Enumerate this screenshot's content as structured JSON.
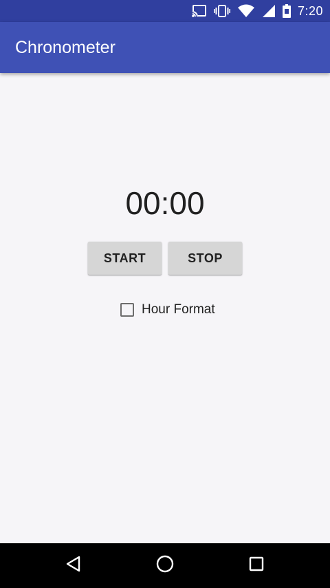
{
  "status_bar": {
    "time": "7:20",
    "icons": [
      "cast-icon",
      "vibrate-icon",
      "wifi-icon",
      "signal-icon",
      "battery-icon"
    ]
  },
  "app_bar": {
    "title": "Chronometer",
    "color": "#3f51b5"
  },
  "main": {
    "chronometer_value": "00:00",
    "start_label": "START",
    "stop_label": "STOP",
    "hour_format": {
      "label": "Hour Format",
      "checked": false
    }
  },
  "nav_bar": {
    "buttons": [
      "back-icon",
      "home-icon",
      "recents-icon"
    ]
  }
}
